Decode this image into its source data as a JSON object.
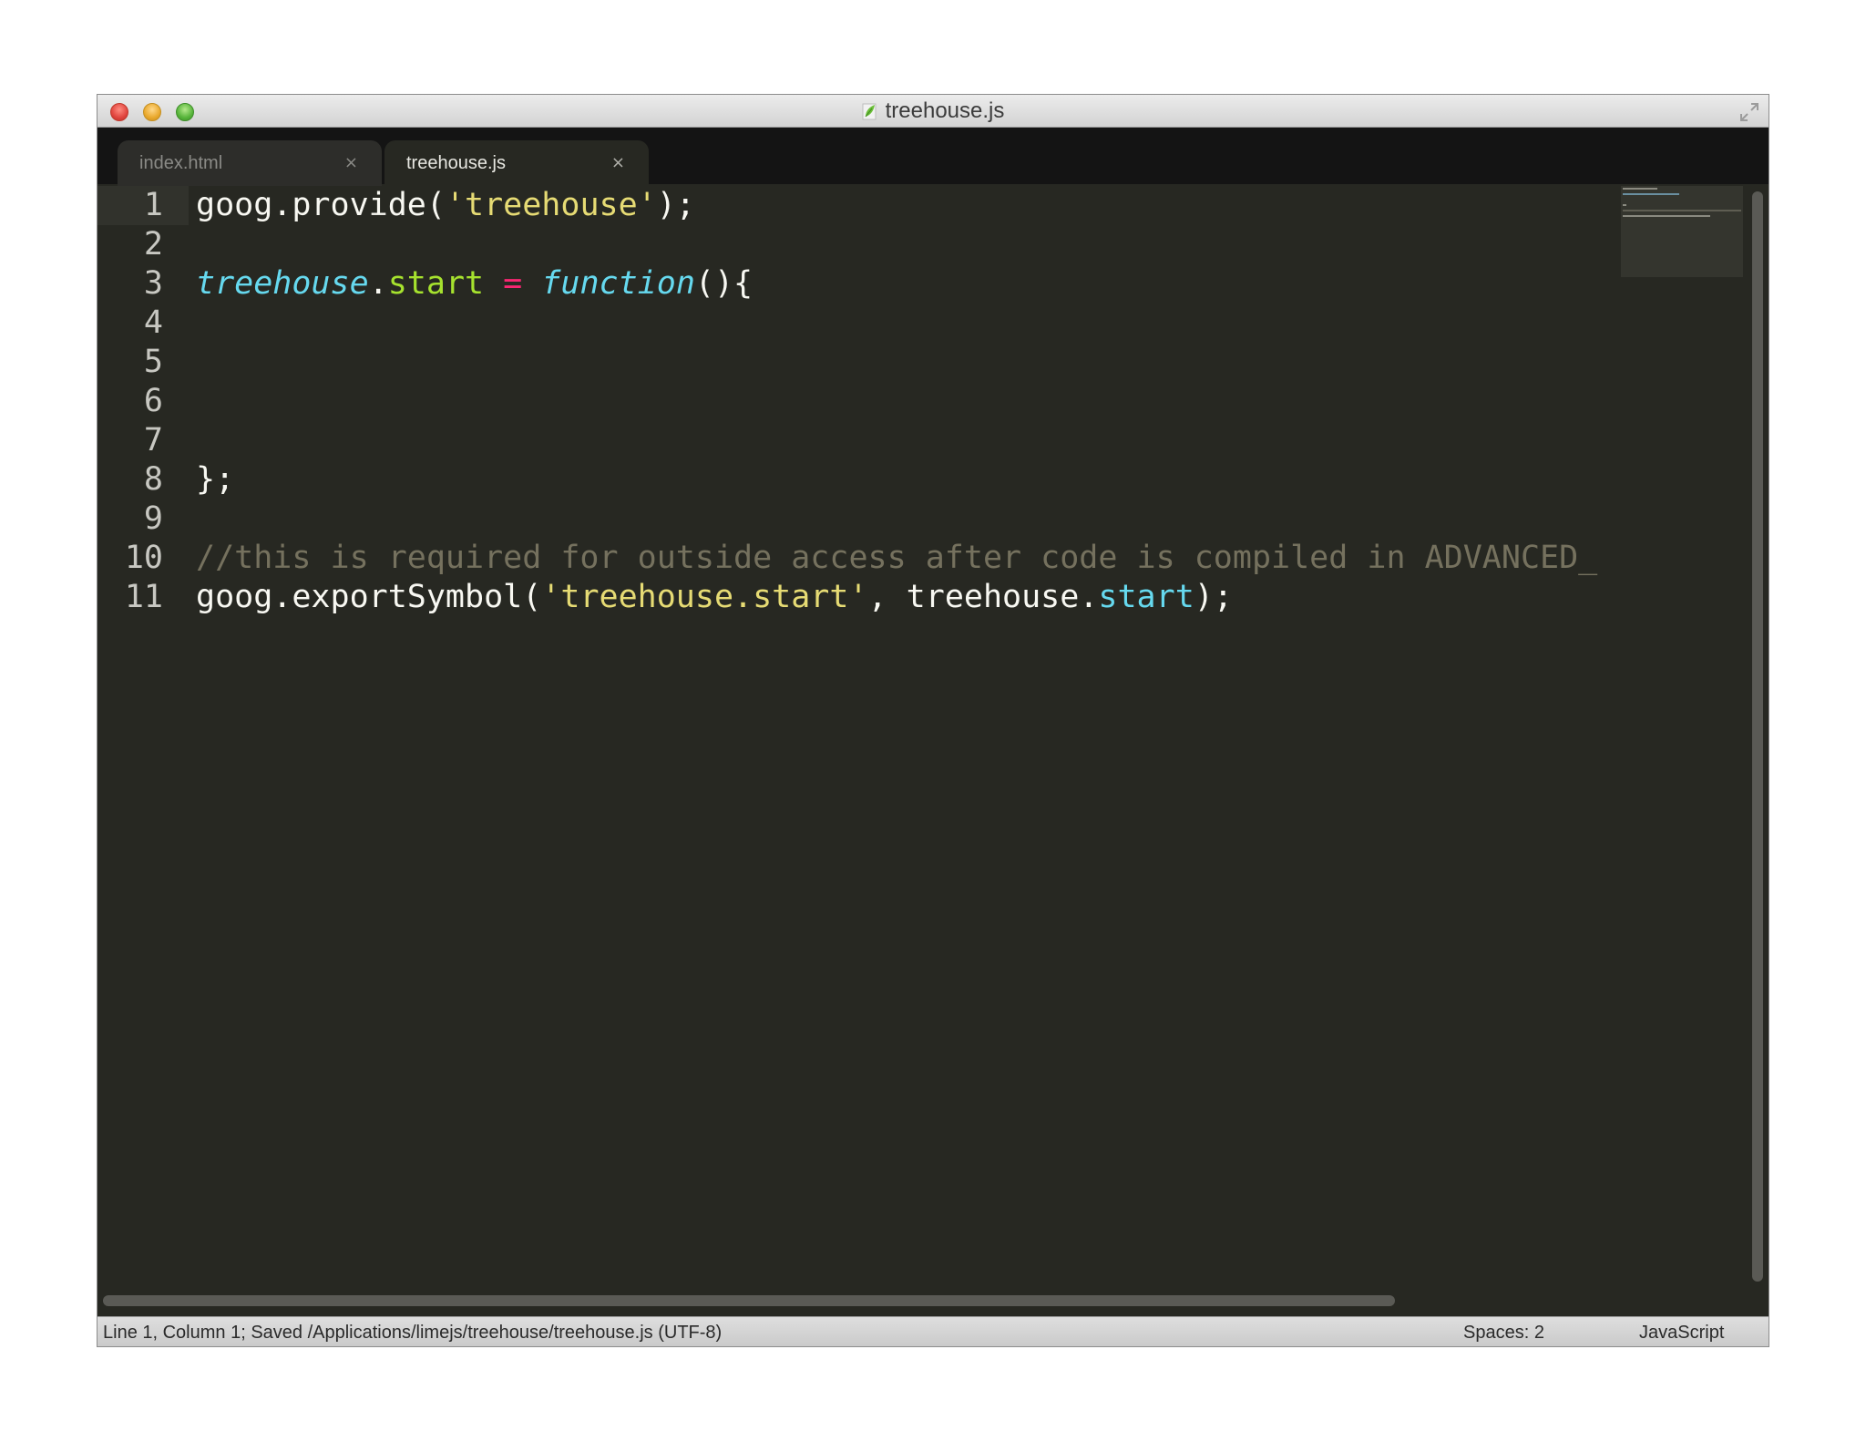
{
  "window": {
    "title": "treehouse.js",
    "title_icon": "leaf-file-icon"
  },
  "tabs": [
    {
      "label": "index.html",
      "close_glyph": "×",
      "active": false
    },
    {
      "label": "treehouse.js",
      "close_glyph": "×",
      "active": true
    }
  ],
  "editor": {
    "current_line": 1,
    "lines": [
      {
        "number": "1",
        "tokens": [
          {
            "text": "goog.provide(",
            "kind": "plain"
          },
          {
            "text": "'treehouse'",
            "kind": "string"
          },
          {
            "text": ");",
            "kind": "plain"
          }
        ]
      },
      {
        "number": "2",
        "tokens": []
      },
      {
        "number": "3",
        "tokens": [
          {
            "text": "treehouse",
            "kind": "ident"
          },
          {
            "text": ".",
            "kind": "plain"
          },
          {
            "text": "start",
            "kind": "prop"
          },
          {
            "text": " ",
            "kind": "plain"
          },
          {
            "text": "=",
            "kind": "op"
          },
          {
            "text": " ",
            "kind": "plain"
          },
          {
            "text": "function",
            "kind": "keyword"
          },
          {
            "text": "(){",
            "kind": "plain"
          }
        ]
      },
      {
        "number": "4",
        "tokens": []
      },
      {
        "number": "5",
        "tokens": []
      },
      {
        "number": "6",
        "tokens": []
      },
      {
        "number": "7",
        "tokens": []
      },
      {
        "number": "8",
        "tokens": [
          {
            "text": "};",
            "kind": "plain"
          }
        ]
      },
      {
        "number": "9",
        "tokens": []
      },
      {
        "number": "10",
        "tokens": [
          {
            "text": "//this is required for outside access after code is compiled in ADVANCED_",
            "kind": "comment"
          }
        ]
      },
      {
        "number": "11",
        "tokens": [
          {
            "text": "goog.exportSymbol(",
            "kind": "plain"
          },
          {
            "text": "'treehouse.start'",
            "kind": "string"
          },
          {
            "text": ", treehouse.",
            "kind": "plain"
          },
          {
            "text": "start",
            "kind": "prop2"
          },
          {
            "text": ");",
            "kind": "plain"
          }
        ]
      }
    ]
  },
  "status_bar": {
    "position_and_path": "Line 1, Column 1; Saved /Applications/limejs/treehouse/treehouse.js (UTF-8)",
    "indentation": "Spaces: 2",
    "syntax": "JavaScript"
  },
  "colors": {
    "editor_background": "#272822",
    "tab_bar_background": "#141414",
    "string": "#e6db74",
    "keyword": "#66d9ef",
    "property": "#a6e22e",
    "operator": "#f92672",
    "comment": "#75715e",
    "plain": "#f8f8f2"
  }
}
